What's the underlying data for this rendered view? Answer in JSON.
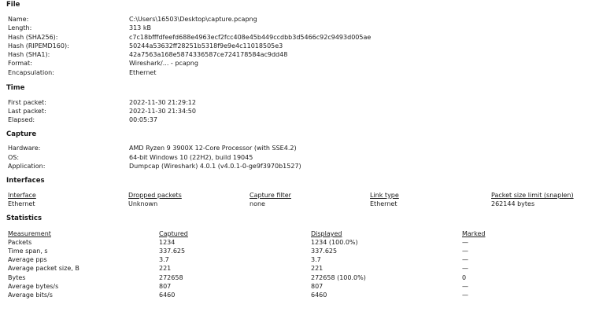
{
  "file": {
    "title": "File",
    "rows": [
      {
        "label": "Name:",
        "value": "C:\\Users\\16503\\Desktop\\capture.pcapng"
      },
      {
        "label": "Length:",
        "value": "313 kB"
      },
      {
        "label": "Hash (SHA256):",
        "value": "c7c18bfffdfeefd688e4963ecf2fcc408e45b449ccdbb3d5466c92c9493d005ae"
      },
      {
        "label": "Hash (RIPEMD160):",
        "value": "50244a53632ff28251b5318f9e9e4c11018505e3"
      },
      {
        "label": "Hash (SHA1):",
        "value": "42a7563a168e5874336587ce724178584ac9dd48"
      },
      {
        "label": "Format:",
        "value": "Wireshark/... - pcapng"
      },
      {
        "label": "Encapsulation:",
        "value": "Ethernet"
      }
    ]
  },
  "time": {
    "title": "Time",
    "rows": [
      {
        "label": "First packet:",
        "value": "2022-11-30 21:29:12"
      },
      {
        "label": "Last packet:",
        "value": "2022-11-30 21:34:50"
      },
      {
        "label": "Elapsed:",
        "value": "00:05:37"
      }
    ]
  },
  "capture": {
    "title": "Capture",
    "rows": [
      {
        "label": "Hardware:",
        "value": "AMD Ryzen 9 3900X 12-Core Processor (with SSE4.2)"
      },
      {
        "label": "OS:",
        "value": "64-bit Windows 10 (22H2), build 19045"
      },
      {
        "label": "Application:",
        "value": "Dumpcap (Wireshark) 4.0.1 (v4.0.1-0-ge9f3970b1527)"
      }
    ]
  },
  "interfaces": {
    "title": "Interfaces",
    "headers": [
      "Interface",
      "Dropped packets",
      "Capture filter",
      "Link type",
      "Packet size limit (snaplen)"
    ],
    "rows": [
      [
        "Ethernet",
        "Unknown",
        "none",
        "Ethernet",
        "262144 bytes"
      ]
    ]
  },
  "statistics": {
    "title": "Statistics",
    "headers": [
      "Measurement",
      "Captured",
      "Displayed",
      "Marked"
    ],
    "rows": [
      [
        "Packets",
        "1234",
        "1234 (100.0%)",
        "—"
      ],
      [
        "Time span, s",
        "337.625",
        "337.625",
        "—"
      ],
      [
        "Average pps",
        "3.7",
        "3.7",
        "—"
      ],
      [
        "Average packet size, B",
        "221",
        "221",
        "—"
      ],
      [
        "Bytes",
        "272658",
        "272658 (100.0%)",
        "0"
      ],
      [
        "Average bytes/s",
        "807",
        "807",
        "—"
      ],
      [
        "Average bits/s",
        "6460",
        "6460",
        "—"
      ]
    ]
  }
}
